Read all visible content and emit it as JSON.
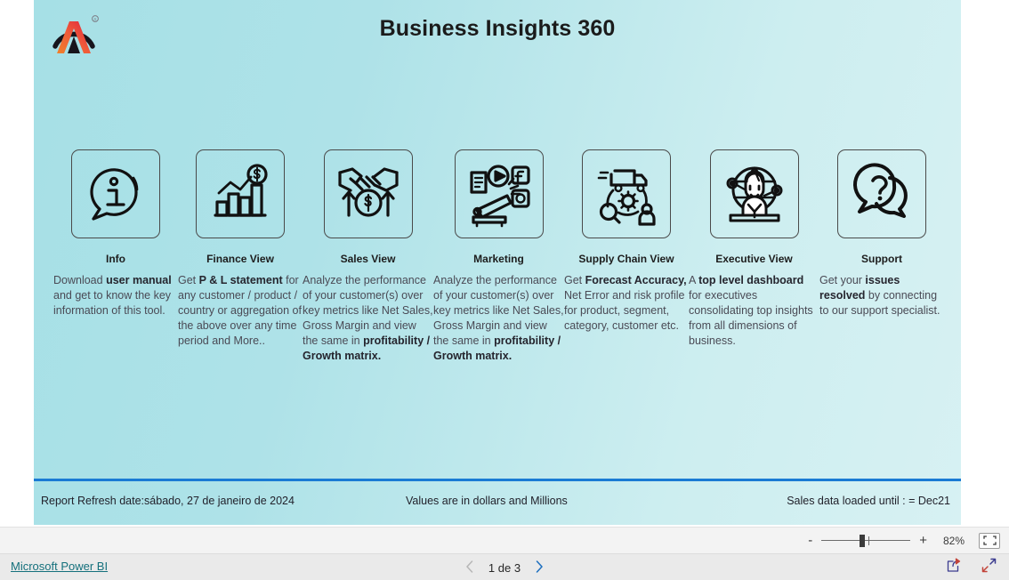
{
  "report": {
    "title": "Business Insights 360",
    "logo_icon": "atliq-logo-icon"
  },
  "cards": [
    {
      "id": "info",
      "icon": "info-speech-bubble-icon",
      "title": "Info",
      "desc_html": " Download <b>user manual</b> and get to know the key information of this tool.",
      "align": "left"
    },
    {
      "id": "finance-view",
      "icon": "bar-chart-dollar-icon",
      "title": "Finance View",
      "desc_html": " Get  <b>P &amp; L statement</b> for any customer / product / country or aggregation of the above over any time period and More..",
      "align": "left"
    },
    {
      "id": "sales-view",
      "icon": "handshake-money-icon",
      "title": "Sales View",
      "desc_html": "Analyze the performance of your customer(s) over key metrics like Net Sales, Gross Margin and view the same in <b>profitability / Growth matrix.</b>",
      "align": "left"
    },
    {
      "id": "marketing",
      "icon": "megaphone-media-icon",
      "title": "Marketing",
      "desc_html": "Analyze the performance of your customer(s) over key metrics like Net Sales, Gross Margin and view the same in <b>profitability / Growth matrix.</b>",
      "align": "left"
    },
    {
      "id": "supply-chain-view",
      "icon": "truck-gear-supply-icon",
      "title": "Supply Chain View",
      "desc_html": " Get <b>Forecast Accuracy,</b> Net Error and risk profile for product, segment, category,  customer etc.",
      "align": "left"
    },
    {
      "id": "executive-view",
      "icon": "executive-globe-person-icon",
      "title": "Executive View",
      "desc_html": "A <b>top level dashboard</b> for executives consolidating top insights from all dimensions of business.",
      "align": "left"
    },
    {
      "id": "support",
      "icon": "question-speech-bubbles-icon",
      "title": "Support",
      "desc_html": "Get your <b>issues resolved</b> by connecting to our support specialist.",
      "align": "left"
    }
  ],
  "footer": {
    "refresh_label": "Report Refresh date:",
    "refresh_date": "sábado, 27 de janeiro de 2024",
    "units_note": "Values are in dollars and Millions",
    "data_note": "Sales data loaded until : = Dec21",
    "rule_color": "#1a7bd4"
  },
  "zoom_bar": {
    "minus_label": "-",
    "plus_label": "+",
    "level": "82%",
    "fit_icon": "fit-to-page-icon"
  },
  "status_bar": {
    "powerbi_link": "Microsoft Power BI",
    "prev_icon": "chevron-left-icon",
    "next_icon": "chevron-right-icon",
    "page_label": "1 de 3",
    "share_icon": "share-icon",
    "fullscreen_icon": "fullscreen-icon"
  },
  "theme": {
    "canvas_gradient_from": "#a6e0e6",
    "canvas_gradient_to": "#d7f1f3",
    "link_color": "#14707c",
    "accent_blue": "#1a7bd4"
  }
}
